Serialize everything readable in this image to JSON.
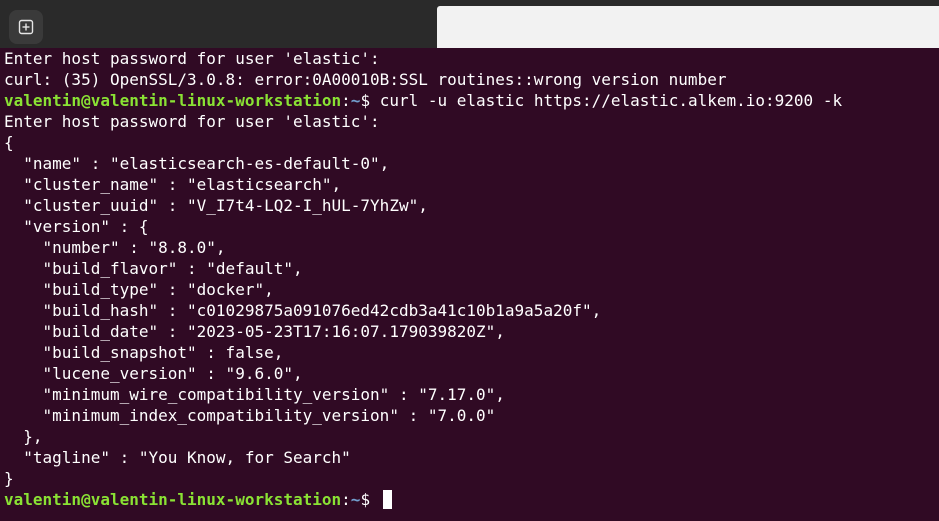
{
  "titlebar": {
    "new_tab_icon": "new-tab-icon"
  },
  "terminal": {
    "colors": {
      "background": "#300a24",
      "text": "#ffffff",
      "prompt_user": "#8ae234",
      "prompt_path": "#729fcf"
    },
    "prompt_user": "valentin@valentin-linux-workstation",
    "prompt_separator": ":",
    "prompt_path": "~",
    "prompt_symbol": "$ ",
    "lines": [
      "Enter host password for user 'elastic':",
      "curl: (35) OpenSSL/3.0.8: error:0A00010B:SSL routines::wrong version number",
      "curl -u elastic https://elastic.alkem.io:9200 -k",
      "Enter host password for user 'elastic':",
      "{",
      "  \"name\" : \"elasticsearch-es-default-0\",",
      "  \"cluster_name\" : \"elasticsearch\",",
      "  \"cluster_uuid\" : \"V_I7t4-LQ2-I_hUL-7YhZw\",",
      "  \"version\" : {",
      "    \"number\" : \"8.8.0\",",
      "    \"build_flavor\" : \"default\",",
      "    \"build_type\" : \"docker\",",
      "    \"build_hash\" : \"c01029875a091076ed42cdb3a41c10b1a9a5a20f\",",
      "    \"build_date\" : \"2023-05-23T17:16:07.179039820Z\",",
      "    \"build_snapshot\" : false,",
      "    \"lucene_version\" : \"9.6.0\",",
      "    \"minimum_wire_compatibility_version\" : \"7.17.0\",",
      "    \"minimum_index_compatibility_version\" : \"7.0.0\"",
      "  },",
      "  \"tagline\" : \"You Know, for Search\"",
      "}"
    ]
  }
}
